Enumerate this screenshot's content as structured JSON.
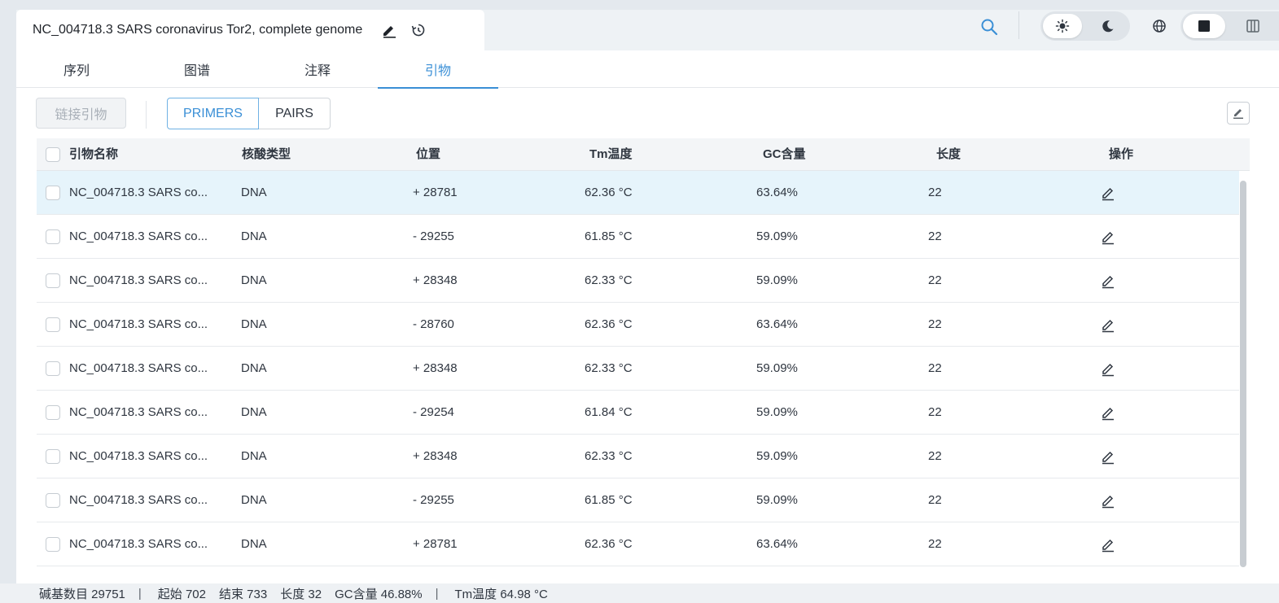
{
  "document_tab": {
    "title": "NC_004718.3 SARS coronavirus Tor2, complete genome"
  },
  "icons": {
    "edit": "pencil-icon",
    "history": "history-icon",
    "search": "search-icon",
    "light_theme": "sun-icon",
    "dark_theme": "moon-icon",
    "language": "globe-icon",
    "layout_single": "single-panel-icon",
    "layout_split": "split-panel-icon",
    "export": "export-icon",
    "row_edit": "pencil-outline-icon"
  },
  "nav_tabs": [
    {
      "label": "序列",
      "active": false
    },
    {
      "label": "图谱",
      "active": false
    },
    {
      "label": "注释",
      "active": false
    },
    {
      "label": "引物",
      "active": true
    }
  ],
  "toolbar": {
    "link_primers_label": "链接引物",
    "view_toggle": [
      {
        "label": "PRIMERS",
        "active": true
      },
      {
        "label": "PAIRS",
        "active": false
      }
    ]
  },
  "table": {
    "columns": [
      "引物名称",
      "核酸类型",
      "位置",
      "Tm温度",
      "GC含量",
      "长度",
      "操作"
    ],
    "rows": [
      {
        "name": "NC_004718.3 SARS co...",
        "type": "DNA",
        "position": "+ 28781",
        "tm": "62.36 °C",
        "gc": "63.64%",
        "length": "22",
        "selected": true
      },
      {
        "name": "NC_004718.3 SARS co...",
        "type": "DNA",
        "position": "- 29255",
        "tm": "61.85 °C",
        "gc": "59.09%",
        "length": "22"
      },
      {
        "name": "NC_004718.3 SARS co...",
        "type": "DNA",
        "position": "+ 28348",
        "tm": "62.33 °C",
        "gc": "59.09%",
        "length": "22"
      },
      {
        "name": "NC_004718.3 SARS co...",
        "type": "DNA",
        "position": "- 28760",
        "tm": "62.36 °C",
        "gc": "63.64%",
        "length": "22"
      },
      {
        "name": "NC_004718.3 SARS co...",
        "type": "DNA",
        "position": "+ 28348",
        "tm": "62.33 °C",
        "gc": "59.09%",
        "length": "22"
      },
      {
        "name": "NC_004718.3 SARS co...",
        "type": "DNA",
        "position": "- 29254",
        "tm": "61.84 °C",
        "gc": "59.09%",
        "length": "22"
      },
      {
        "name": "NC_004718.3 SARS co...",
        "type": "DNA",
        "position": "+ 28348",
        "tm": "62.33 °C",
        "gc": "59.09%",
        "length": "22"
      },
      {
        "name": "NC_004718.3 SARS co...",
        "type": "DNA",
        "position": "- 29255",
        "tm": "61.85 °C",
        "gc": "59.09%",
        "length": "22"
      },
      {
        "name": "NC_004718.3 SARS co...",
        "type": "DNA",
        "position": "+ 28781",
        "tm": "62.36 °C",
        "gc": "63.64%",
        "length": "22"
      }
    ]
  },
  "status_bar": {
    "base_count": "碱基数目 29751",
    "start": "起始 702",
    "end": "结束 733",
    "length": "长度 32",
    "gc": "GC含量 46.88%",
    "tm": "Tm温度 64.98 °C",
    "separator": "|"
  },
  "colors": {
    "accent": "#3a8fd6",
    "selected_row": "#e6f4fb"
  }
}
